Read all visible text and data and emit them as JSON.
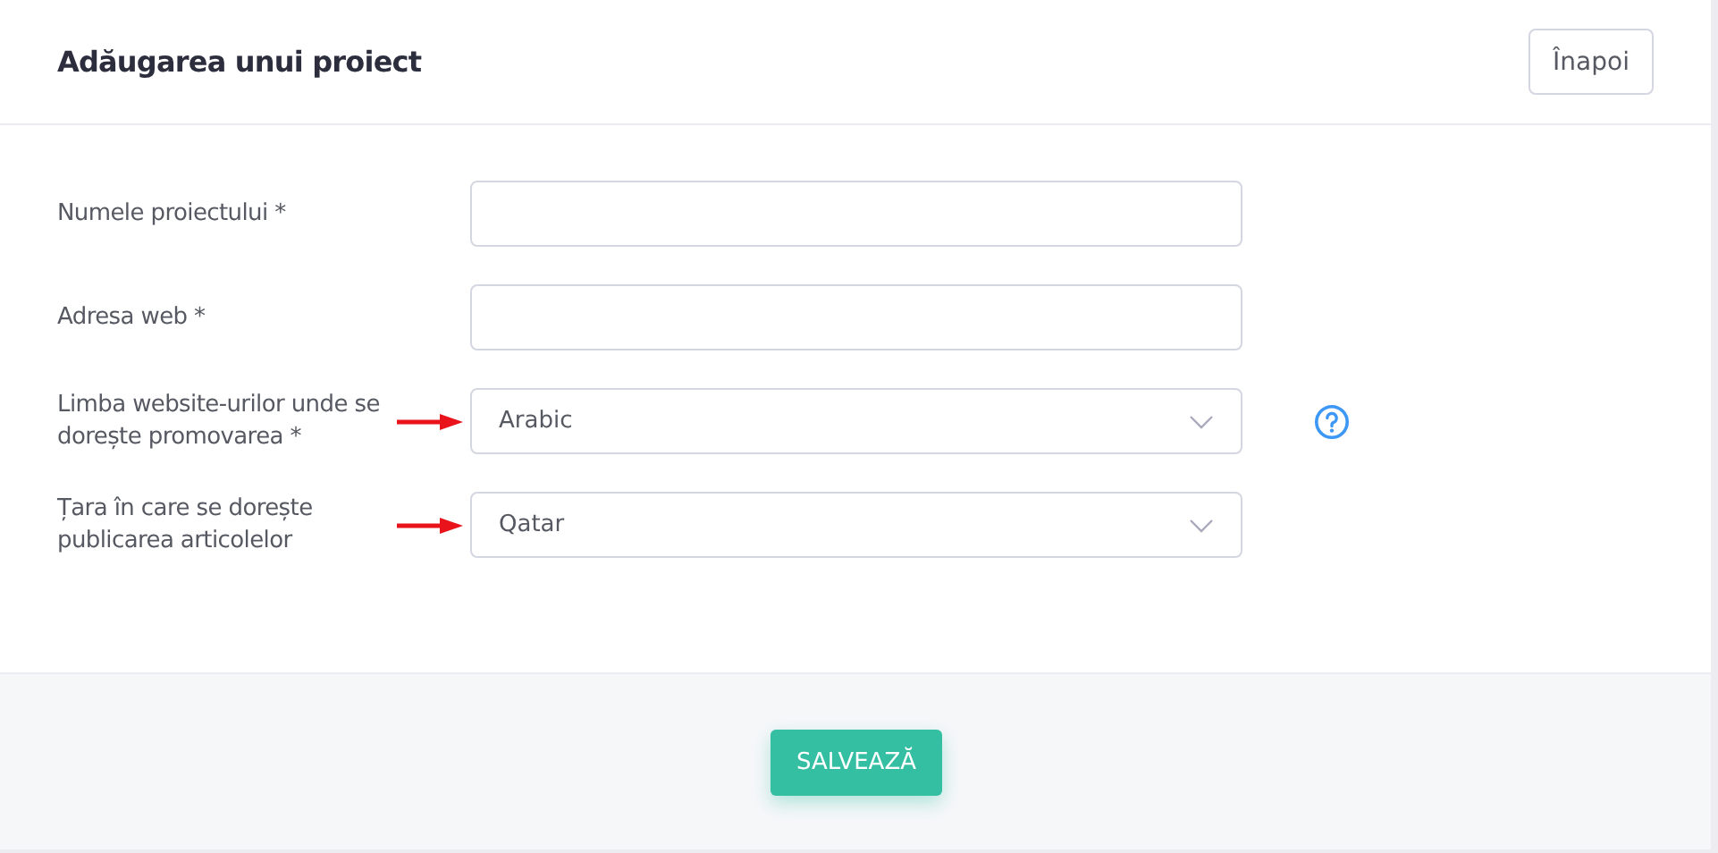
{
  "header": {
    "title": "Adăugarea unui proiect",
    "back_button": "Înapoi"
  },
  "fields": [
    {
      "kind": "text",
      "label": "Numele proiectului *",
      "marked": false,
      "help": false
    },
    {
      "kind": "text",
      "label": "Adresa web *",
      "marked": false,
      "help": false
    },
    {
      "kind": "select",
      "label": "Limba website-urilor unde se dorește promovarea *",
      "value": "Arabic",
      "marked": true,
      "help": true
    },
    {
      "kind": "select",
      "label": "Țara în care se dorește publicarea articolelor",
      "value": "Qatar",
      "marked": true,
      "help": false
    }
  ],
  "footer": {
    "save_button": "SALVEAZĂ"
  }
}
